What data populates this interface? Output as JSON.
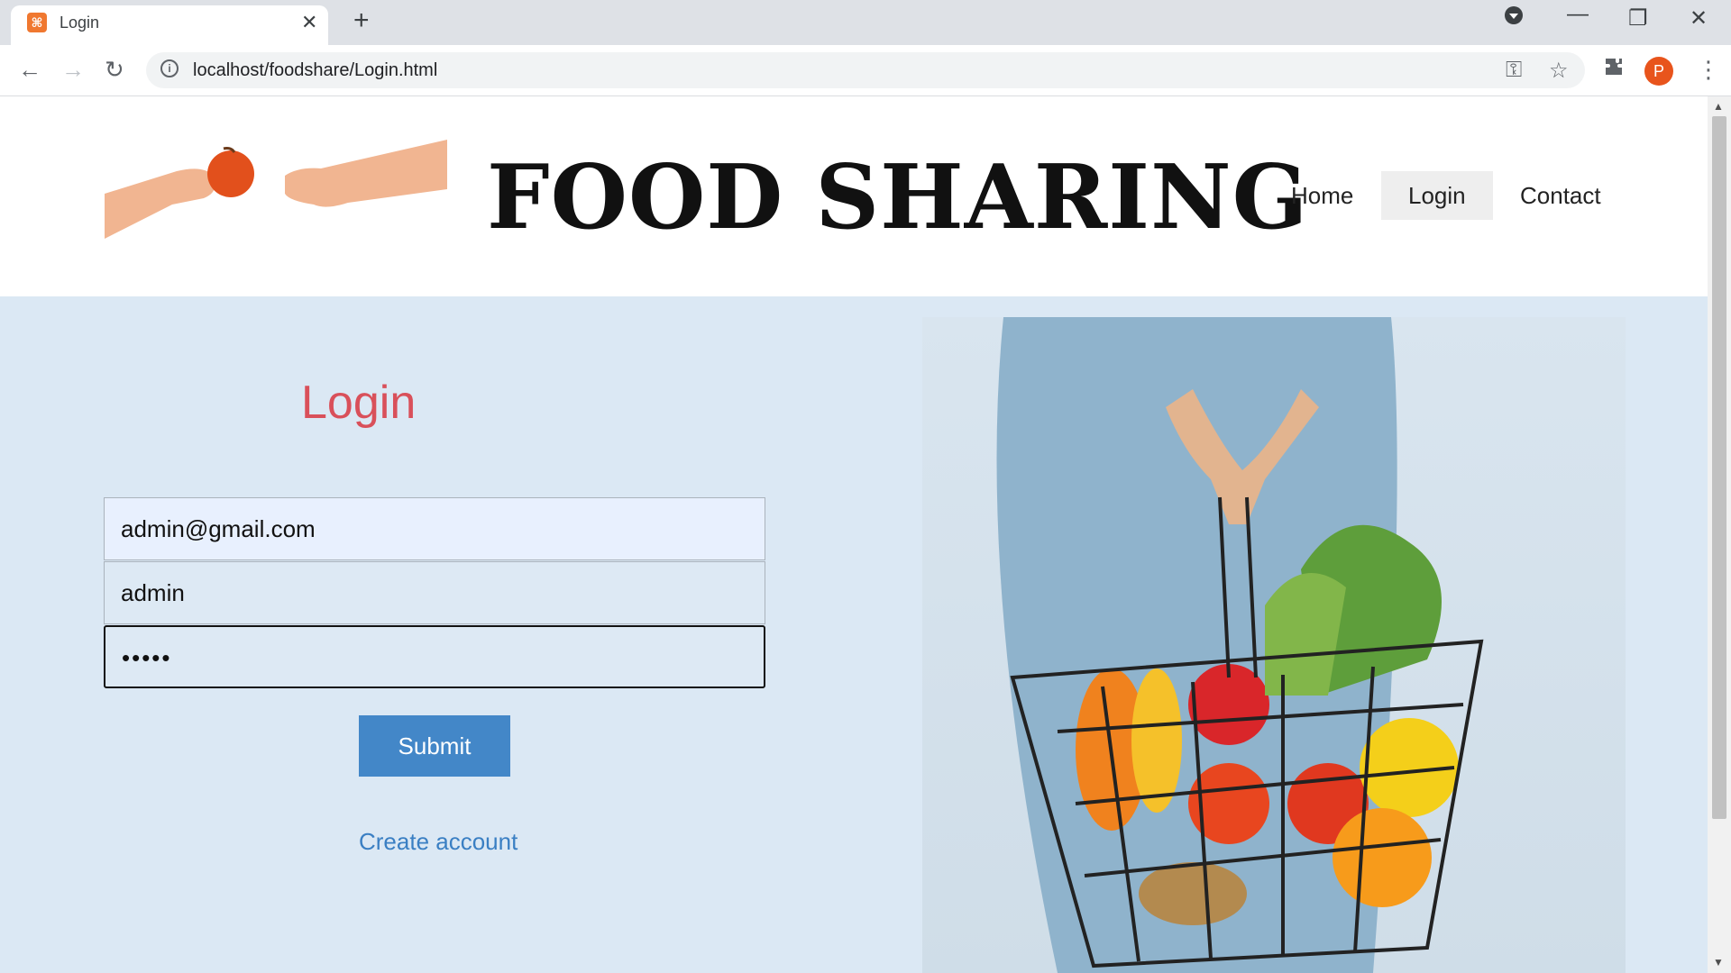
{
  "browser": {
    "tab_title": "Login",
    "tab_favicon_text": "⌘",
    "url": "localhost/foodshare/Login.html",
    "profile_initial": "P"
  },
  "site": {
    "brand": "FOOD SHARING",
    "nav": [
      "Home",
      "Login",
      "Contact"
    ]
  },
  "login": {
    "title": "Login",
    "email_value": "admin@gmail.com",
    "username_value": "admin",
    "password_value": "•••••",
    "submit_label": "Submit",
    "create_account_label": "Create account"
  },
  "colors": {
    "login_title": "#d9505a",
    "submit_bg": "#4387c8",
    "link": "#3a7fc3",
    "page_bg": "#dbe8f4"
  }
}
